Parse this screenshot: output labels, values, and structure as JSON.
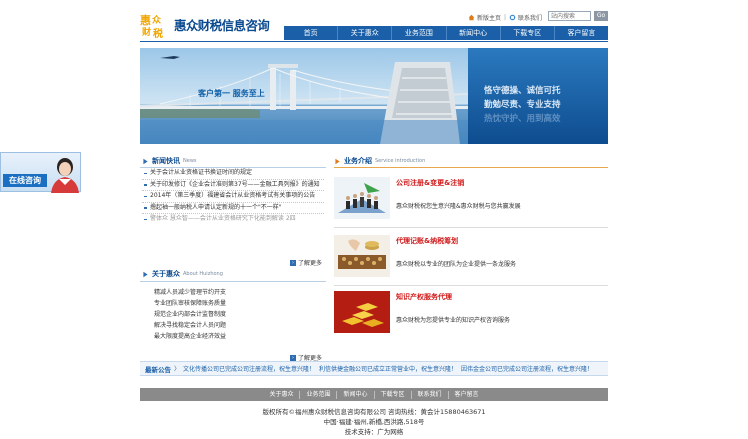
{
  "brand": {
    "logo_chars": [
      "惠",
      "众",
      "财",
      "税"
    ],
    "name": "惠众财税信息咨询",
    "colors": {
      "primary": "#1a5fa8",
      "accent": "#f2a500",
      "highlight": "#d11a1a"
    }
  },
  "top_links": {
    "home": "新版主页",
    "contact": "联系我们",
    "home_icon": "house-icon",
    "contact_icon": "phone-icon"
  },
  "search": {
    "placeholder": "站内搜索",
    "button": "Go"
  },
  "nav": {
    "items": [
      "首页",
      "关于惠众",
      "业务范围",
      "新闻中心",
      "下载专区",
      "客户留言"
    ]
  },
  "banner": {
    "slogan": "客户第一  服务至上",
    "lines": [
      "恪守德操、诚信可托",
      "勤勉尽责、专业支持",
      "热忱守护、用到高效"
    ]
  },
  "consult": {
    "label": "在线咨询"
  },
  "news": {
    "title": "新闻快讯",
    "subtitle": "News",
    "items": [
      "关于会计从业资格证书换证时间的规定",
      "关于印发修订《企业会计准则第37号——金融工具列报》的通知",
      "2014年（第三季度）福建省会计从业资格考试有关事项的公告",
      "撸起袖一般纳税人申请认定新规的十一个\"不一样\"",
      "警体众 慧众智——会计从业资格研究下化能到解读 2四"
    ],
    "more": "了解更多"
  },
  "about": {
    "title": "关于惠众",
    "subtitle": "About Huizhong",
    "items": [
      "精减人员减少管理节约开支",
      "专业团队审核保障账务质量",
      "规范企业内部会计监督制度",
      "解决寻找稳定会计人员问题",
      "最大限度提高企业经济效益"
    ],
    "more": "了解更多"
  },
  "services": {
    "title": "业务介绍",
    "subtitle": "Service introduction",
    "items": [
      {
        "title": "公司注册&变更&注销",
        "desc": "惠众财税祝您生意兴隆&惠众财税与您共赢发展",
        "icon": "business-team-image"
      },
      {
        "title": "代理记账&纳税筹划",
        "desc": "惠众财税以专业的团队为企业提供一条龙服务",
        "icon": "abacus-coins-image"
      },
      {
        "title": "知识产权服务代理",
        "desc": "惠众财税为您提供专业的知识产权咨询服务",
        "icon": "gold-bars-image"
      }
    ]
  },
  "ticker": {
    "label": "最新公告",
    "items": [
      "文化传播公司已完成公司注册流程，祝生意兴隆！",
      "利信供捷金融公司已成立正常营业中，祝生意兴隆！",
      "因伟金金公司已完成公司注册流程，祝生意兴隆！"
    ]
  },
  "footer": {
    "nav": [
      "关于惠众",
      "业务范围",
      "新闻中心",
      "下载专区",
      "联系我们",
      "客户留言"
    ],
    "info": [
      "版权所有©福州惠众财税信息咨询有限公司  咨询热线：黄会计15880463671",
      "中国·福建·福州,新橋,西洪路,518号",
      "技术支持：广为网络"
    ]
  }
}
